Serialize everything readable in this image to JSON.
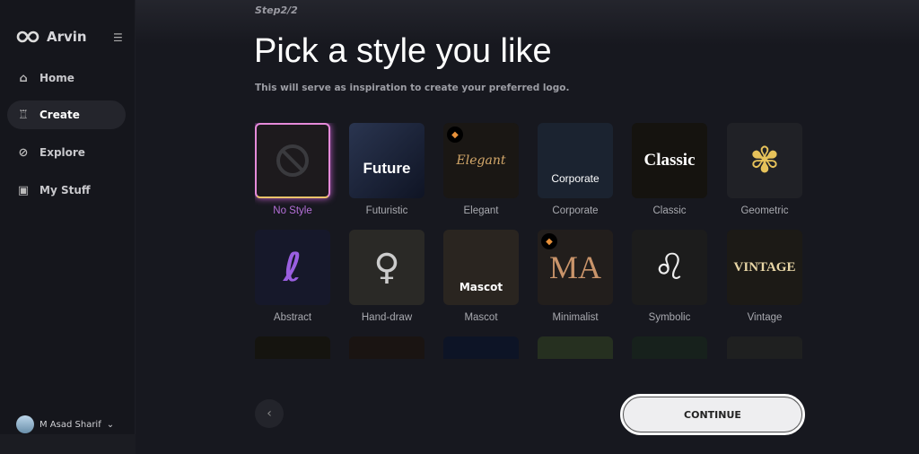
{
  "sidebar": {
    "brand": "Arvin",
    "items": [
      {
        "label": "Home",
        "icon": "home-icon"
      },
      {
        "label": "Create",
        "icon": "brush-icon",
        "active": true
      },
      {
        "label": "Explore",
        "icon": "compass-icon"
      },
      {
        "label": "My Stuff",
        "icon": "gallery-icon"
      }
    ],
    "user": {
      "name": "M Asad Sharif"
    }
  },
  "main": {
    "step": "Step2/2",
    "title": "Pick a style you like",
    "subtitle": "This will serve as inspiration to create your preferred logo.",
    "styles": [
      {
        "label": "No Style",
        "thumb": "",
        "selected": true
      },
      {
        "label": "Futuristic",
        "thumb": "Future"
      },
      {
        "label": "Elegant",
        "thumb": "Elegant",
        "premium": true
      },
      {
        "label": "Corporate",
        "thumb": "Corporate"
      },
      {
        "label": "Classic",
        "thumb": "Classic"
      },
      {
        "label": "Geometric",
        "thumb": ""
      },
      {
        "label": "Abstract",
        "thumb": ""
      },
      {
        "label": "Hand-draw",
        "thumb": ""
      },
      {
        "label": "Mascot",
        "thumb": "Mascot"
      },
      {
        "label": "Minimalist",
        "thumb": "MA",
        "premium": true
      },
      {
        "label": "Symbolic",
        "thumb": ""
      },
      {
        "label": "Vintage",
        "thumb": "VINTAGE"
      }
    ],
    "continue_label": "CONTINUE"
  },
  "colors": {
    "accent": "#b56fd8",
    "background": "#17181f"
  }
}
